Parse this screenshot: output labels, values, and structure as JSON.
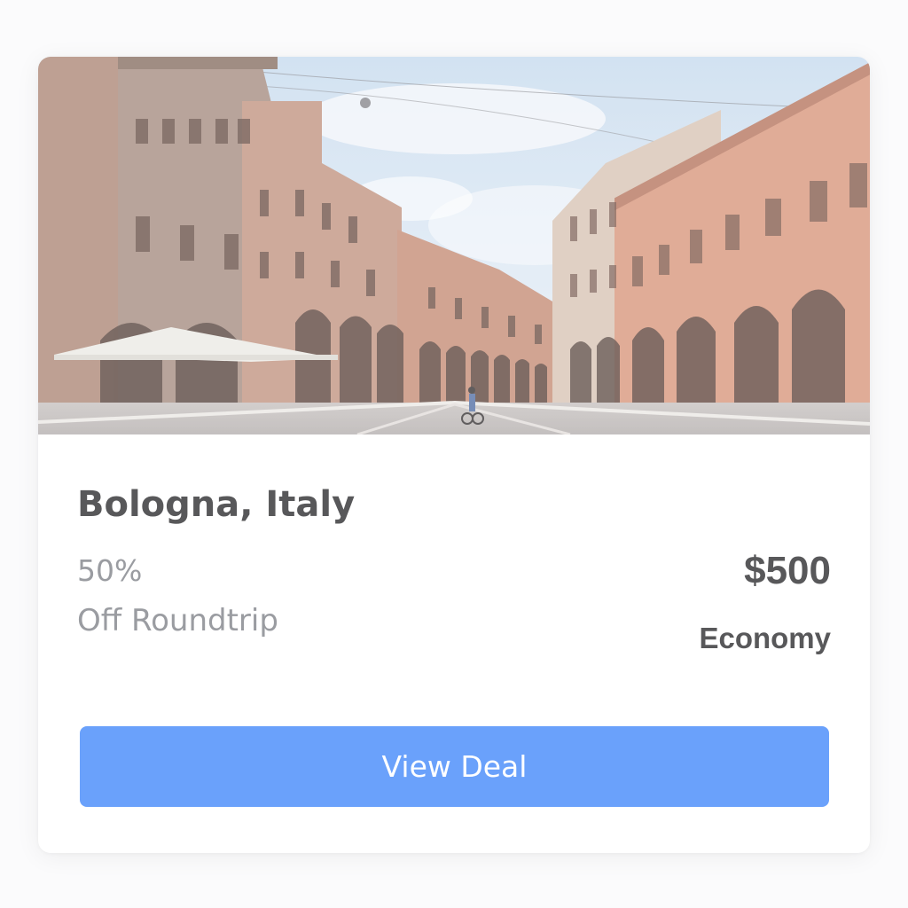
{
  "deal": {
    "destination": "Bologna, Italy",
    "discount": "50%",
    "discount_description": "Off Roundtrip",
    "price": "$500",
    "cabin_class": "Economy",
    "cta_label": "View Deal"
  },
  "colors": {
    "card_background": "#ffffff",
    "title_text": "#58585a",
    "muted_text": "#9a9ca1",
    "button_background": "#6aa1fb",
    "button_text": "#ffffff"
  },
  "image": {
    "subject": "photo-piazza-arcaded-buildings"
  }
}
